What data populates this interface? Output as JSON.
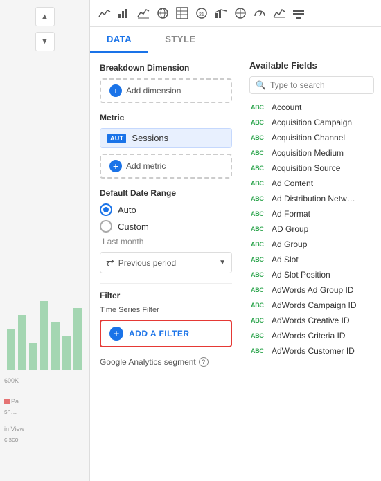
{
  "toolbar": {
    "tabs": [
      "DATA",
      "STYLE"
    ],
    "active_tab": "DATA"
  },
  "form": {
    "breakdown_label": "Breakdown Dimension",
    "add_dimension_label": "Add dimension",
    "metric_label": "Metric",
    "metric_badge": "AUT",
    "metric_name": "Sessions",
    "add_metric_label": "Add metric",
    "date_range_label": "Default Date Range",
    "auto_label": "Auto",
    "custom_label": "Custom",
    "last_month_label": "Last month",
    "previous_period_label": "Previous period",
    "filter_label": "Filter",
    "time_series_filter_label": "Time Series Filter",
    "add_filter_label": "ADD A FILTER",
    "ga_segment_label": "Google Analytics segment"
  },
  "fields_panel": {
    "title": "Available Fields",
    "search_placeholder": "Type to search",
    "fields": [
      {
        "type": "ABC",
        "name": "Account"
      },
      {
        "type": "ABC",
        "name": "Acquisition Campaign"
      },
      {
        "type": "ABC",
        "name": "Acquisition Channel"
      },
      {
        "type": "ABC",
        "name": "Acquisition Medium"
      },
      {
        "type": "ABC",
        "name": "Acquisition Source"
      },
      {
        "type": "ABC",
        "name": "Ad Content"
      },
      {
        "type": "ABC",
        "name": "Ad Distribution Netw…"
      },
      {
        "type": "ABC",
        "name": "Ad Format"
      },
      {
        "type": "ABC",
        "name": "AD Group"
      },
      {
        "type": "ABC",
        "name": "Ad Group"
      },
      {
        "type": "ABC",
        "name": "Ad Slot"
      },
      {
        "type": "ABC",
        "name": "Ad Slot Position"
      },
      {
        "type": "ABC",
        "name": "AdWords Ad Group ID"
      },
      {
        "type": "ABC",
        "name": "AdWords Campaign ID"
      },
      {
        "type": "ABC",
        "name": "AdWords Creative ID"
      },
      {
        "type": "ABC",
        "name": "AdWords Criteria ID"
      },
      {
        "type": "ABC",
        "name": "AdWords Customer ID"
      }
    ]
  },
  "sidebar": {
    "chart_value": "600K",
    "legend_label": "Pa…",
    "legend_sub": "sh…",
    "bottom_label": "in View",
    "bottom_sub": "cisco"
  },
  "icons": {
    "line_chart": "📈",
    "bar_chart": "📊",
    "area_chart": "📉",
    "globe": "🌐",
    "grid": "⊞",
    "number": "21",
    "combo": "⬛",
    "center": "⊕",
    "gauge": "◎",
    "scatter": "⋯"
  }
}
